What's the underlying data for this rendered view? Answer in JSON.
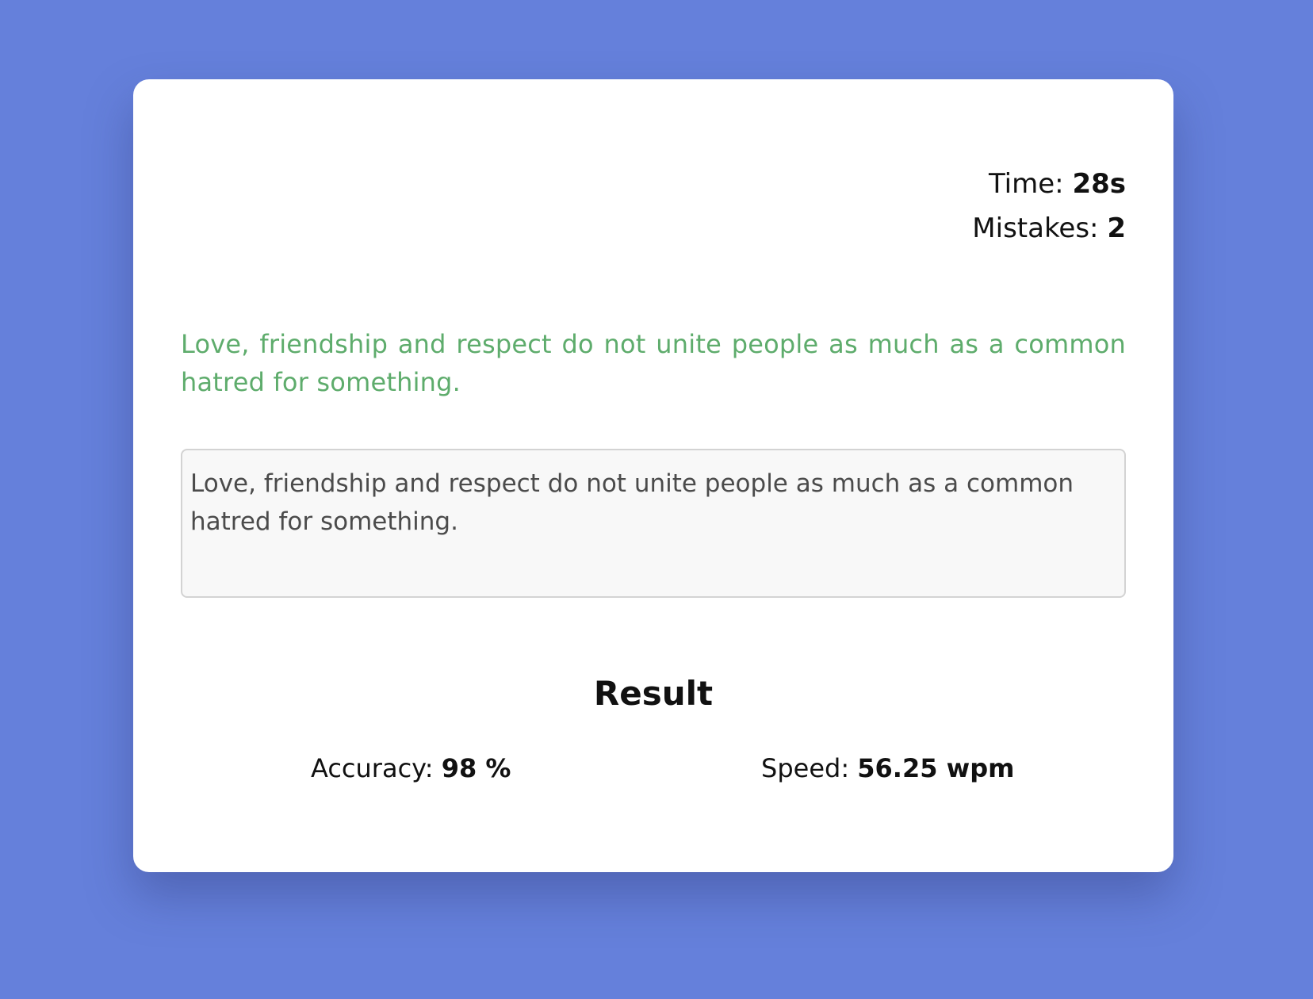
{
  "stats": {
    "time_label": "Time: ",
    "time_value": "28s",
    "mistakes_label": "Mistakes: ",
    "mistakes_value": "2"
  },
  "quote": {
    "text": "Love, friendship and respect do not unite people as much as a common hatred for something.",
    "color": "#5eac6c"
  },
  "input": {
    "value": "Love, friendship and respect do not unite people as much as a common hatred for something."
  },
  "result": {
    "title": "Result",
    "accuracy_label": "Accuracy: ",
    "accuracy_value": "98 %",
    "speed_label": "Speed: ",
    "speed_value": "56.25 wpm"
  },
  "colors": {
    "background": "#6580db",
    "card": "#ffffff",
    "input_bg": "#f8f8f8"
  }
}
